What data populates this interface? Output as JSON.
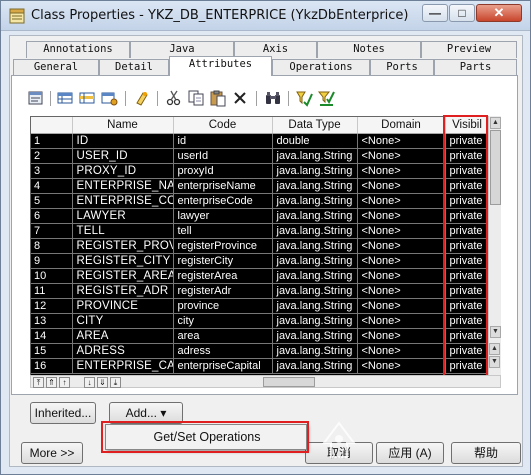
{
  "window": {
    "title": "Class Properties - YKZ_DB_ENTERPRICE (YkzDbEnterprice)",
    "controls": {
      "minimize": "—",
      "maximize": "□",
      "close": "✕"
    }
  },
  "tabs": {
    "row1": [
      "Annotations",
      "Java",
      "Axis",
      "Notes",
      "Preview"
    ],
    "row2": [
      "General",
      "Detail",
      "Attributes",
      "Operations",
      "Ports",
      "Parts"
    ],
    "active": "Attributes"
  },
  "toolbar": {
    "icons": [
      "properties-icon",
      "add-row-icon",
      "insert-row-icon",
      "add-attributes-icon",
      "find-icon",
      "cut-icon",
      "copy-icon",
      "paste-icon",
      "delete-icon",
      "binoculars-icon",
      "filter-icon",
      "filter-settings-icon"
    ]
  },
  "grid": {
    "columns": [
      "",
      "Name",
      "Code",
      "Data Type",
      "Domain",
      "Visibil"
    ],
    "rows": [
      [
        "1",
        "ID",
        "id",
        "double",
        "<None>",
        "private"
      ],
      [
        "2",
        "USER_ID",
        "userId",
        "java.lang.String",
        "<None>",
        "private"
      ],
      [
        "3",
        "PROXY_ID",
        "proxyId",
        "java.lang.String",
        "<None>",
        "private"
      ],
      [
        "4",
        "ENTERPRISE_NA",
        "enterpriseName",
        "java.lang.String",
        "<None>",
        "private"
      ],
      [
        "5",
        "ENTERPRISE_CO",
        "enterpriseCode",
        "java.lang.String",
        "<None>",
        "private"
      ],
      [
        "6",
        "LAWYER",
        "lawyer",
        "java.lang.String",
        "<None>",
        "private"
      ],
      [
        "7",
        "TELL",
        "tell",
        "java.lang.String",
        "<None>",
        "private"
      ],
      [
        "8",
        "REGISTER_PROVI",
        "registerProvince",
        "java.lang.String",
        "<None>",
        "private"
      ],
      [
        "9",
        "REGISTER_CITY",
        "registerCity",
        "java.lang.String",
        "<None>",
        "private"
      ],
      [
        "10",
        "REGISTER_AREA",
        "registerArea",
        "java.lang.String",
        "<None>",
        "private"
      ],
      [
        "11",
        "REGISTER_ADR",
        "registerAdr",
        "java.lang.String",
        "<None>",
        "private"
      ],
      [
        "12",
        "PROVINCE",
        "province",
        "java.lang.String",
        "<None>",
        "private"
      ],
      [
        "13",
        "CITY",
        "city",
        "java.lang.String",
        "<None>",
        "private"
      ],
      [
        "14",
        "AREA",
        "area",
        "java.lang.String",
        "<None>",
        "private"
      ],
      [
        "15",
        "ADRESS",
        "adress",
        "java.lang.String",
        "<None>",
        "private"
      ],
      [
        "16",
        "ENTERPRISE_CA",
        "enterpriseCapital",
        "java.lang.String",
        "<None>",
        "private"
      ]
    ]
  },
  "nav_buttons": [
    "⤒",
    "⇑",
    "↑",
    "↓",
    "⇓",
    "⤓"
  ],
  "buttons": {
    "inherited": "Inherited...",
    "add": "Add...",
    "add_arrow": "▾",
    "more": "More >>",
    "ok": "",
    "cancel": "取消",
    "apply": "应用 (A)",
    "help": "帮助"
  },
  "dropdown": {
    "items": [
      "Get/Set Operations"
    ]
  },
  "colors": {
    "highlight": "#e02020",
    "grid_bg": "#000000",
    "title_bar": "#c3d3e8"
  }
}
